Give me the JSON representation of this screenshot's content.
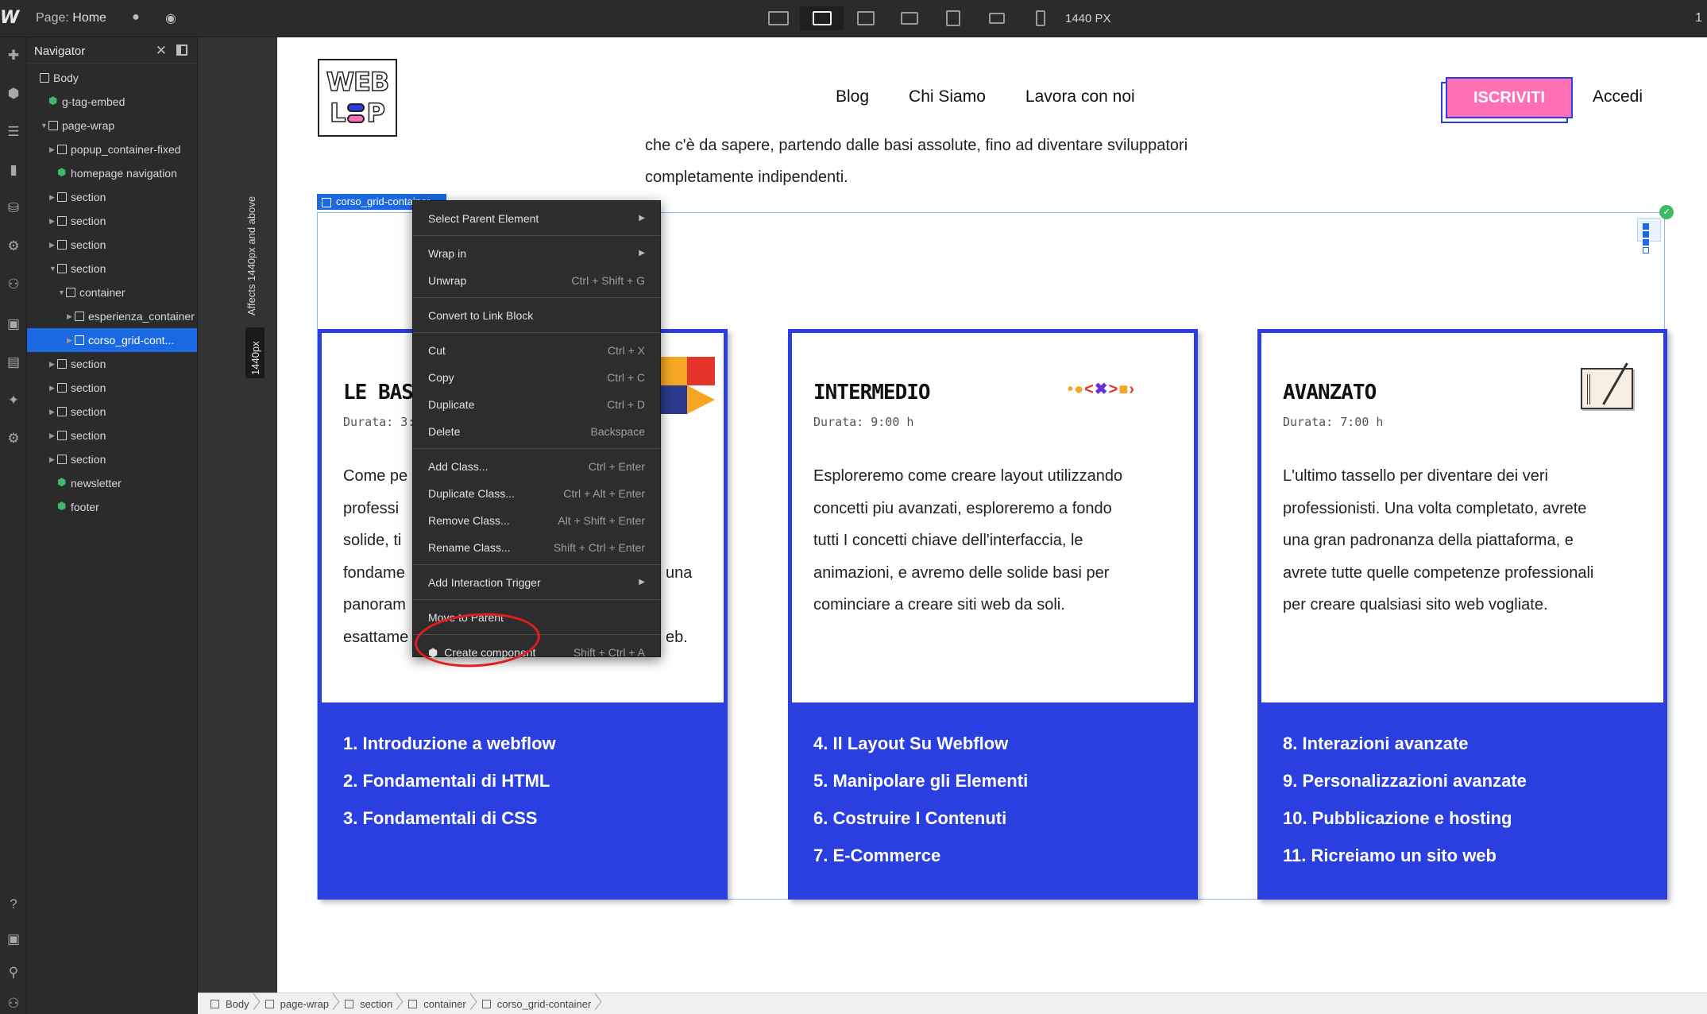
{
  "topbar": {
    "page_prefix": "Page:",
    "page_name": "Home",
    "breakpoint_width": "1440 PX",
    "right_value": "1"
  },
  "navigator": {
    "title": "Navigator",
    "tree": [
      {
        "label": "Body",
        "level": 0,
        "icon": "box",
        "caret": false
      },
      {
        "label": "g-tag-embed",
        "level": 1,
        "icon": "component",
        "caret": false
      },
      {
        "label": "page-wrap",
        "level": 1,
        "icon": "box",
        "caret": "open"
      },
      {
        "label": "popup_container-fixed",
        "level": 2,
        "icon": "box",
        "caret": "closed"
      },
      {
        "label": "homepage navigation",
        "level": 2,
        "icon": "component",
        "caret": false
      },
      {
        "label": "section",
        "level": 2,
        "icon": "box",
        "caret": "closed"
      },
      {
        "label": "section",
        "level": 2,
        "icon": "box",
        "caret": "closed"
      },
      {
        "label": "section",
        "level": 2,
        "icon": "box",
        "caret": "closed"
      },
      {
        "label": "section",
        "level": 2,
        "icon": "box",
        "caret": "open"
      },
      {
        "label": "container",
        "level": 3,
        "icon": "box",
        "caret": "open"
      },
      {
        "label": "esperienza_container",
        "level": 4,
        "icon": "box",
        "caret": "closed"
      },
      {
        "label": "corso_grid-cont...",
        "level": 4,
        "icon": "box",
        "caret": "closed",
        "selected": true
      },
      {
        "label": "section",
        "level": 2,
        "icon": "box",
        "caret": "closed"
      },
      {
        "label": "section",
        "level": 2,
        "icon": "box",
        "caret": "closed"
      },
      {
        "label": "section",
        "level": 2,
        "icon": "box",
        "caret": "closed"
      },
      {
        "label": "section",
        "level": 2,
        "icon": "box",
        "caret": "closed"
      },
      {
        "label": "section",
        "level": 2,
        "icon": "box",
        "caret": "closed"
      },
      {
        "label": "newsletter",
        "level": 2,
        "icon": "component",
        "caret": false
      },
      {
        "label": "footer",
        "level": 2,
        "icon": "component",
        "caret": false
      }
    ]
  },
  "gutter": {
    "affects_text": "Affects 1440px and above",
    "width_tag": "1440px"
  },
  "site": {
    "logo_line1": "WEB",
    "logo_l": "L",
    "logo_p": "P",
    "nav": [
      "Blog",
      "Chi Siamo",
      "Lavora con noi"
    ],
    "cta": "ISCRIVITI",
    "login": "Accedi",
    "intro_line1": "che c'è da sapere, partendo dalle basi assolute, fino ad diventare sviluppatori",
    "intro_line2": "completamente indipendenti.",
    "selected_tag": "corso_grid-container",
    "cards": [
      {
        "title": "LE BASI",
        "duration": "Durata: 3:",
        "desc": [
          "Come pe",
          "professi",
          "solide, ti",
          "fondame",
          "panoram",
          "esattame"
        ],
        "desc_tail": [
          "",
          "",
          "",
          "una",
          "",
          "eb."
        ],
        "lessons": [
          "1. Introduzione a webflow",
          "2. Fondamentali di HTML",
          "3. Fondamentali di CSS"
        ]
      },
      {
        "title": "INTERMEDIO",
        "duration": "Durata: 9:00 h",
        "desc": [
          "Esploreremo come creare layout utilizzando",
          "concetti piu avanzati, esploreremo a fondo",
          "tutti I concetti chiave dell'interfaccia, le",
          "animazioni, e avremo delle solide basi per",
          "cominciare a creare siti web da soli."
        ],
        "lessons": [
          "4. Il Layout Su Webflow",
          "5. Manipolare gli Elementi",
          "6. Costruire I Contenuti",
          "7. E-Commerce"
        ]
      },
      {
        "title": "AVANZATO",
        "duration": "Durata: 7:00 h",
        "desc": [
          "L'ultimo tassello per diventare dei veri",
          "professionisti. Una volta completato, avrete",
          "una gran padronanza della piattaforma, e",
          "avrete tutte quelle competenze professionali",
          "per creare qualsiasi sito web vogliate."
        ],
        "lessons": [
          "8. Interazioni avanzate",
          "9. Personalizzazioni avanzate",
          "10. Pubblicazione e hosting",
          "11. Ricreiamo un sito web"
        ]
      }
    ]
  },
  "context_menu": {
    "items": [
      {
        "label": "Select Parent Element",
        "shortcut": "",
        "submenu": true,
        "sep_after": true
      },
      {
        "label": "Wrap in",
        "shortcut": "",
        "submenu": true
      },
      {
        "label": "Unwrap",
        "shortcut": "Ctrl + Shift + G",
        "sep_after": true
      },
      {
        "label": "Convert to Link Block",
        "shortcut": "",
        "sep_after": true
      },
      {
        "label": "Cut",
        "shortcut": "Ctrl + X"
      },
      {
        "label": "Copy",
        "shortcut": "Ctrl + C"
      },
      {
        "label": "Duplicate",
        "shortcut": "Ctrl + D"
      },
      {
        "label": "Delete",
        "shortcut": "Backspace",
        "sep_after": true
      },
      {
        "label": "Add Class...",
        "shortcut": "Ctrl + Enter"
      },
      {
        "label": "Duplicate Class...",
        "shortcut": "Ctrl + Alt + Enter"
      },
      {
        "label": "Remove Class...",
        "shortcut": "Alt + Shift + Enter"
      },
      {
        "label": "Rename Class...",
        "shortcut": "Shift + Ctrl + Enter",
        "sep_after": true
      },
      {
        "label": "Add Interaction Trigger",
        "shortcut": "",
        "submenu": true,
        "sep_after": true
      },
      {
        "label": "Move to Parent",
        "shortcut": "",
        "sep_after": true
      },
      {
        "label": "Create component",
        "shortcut": "Shift + Ctrl + A",
        "icon": "component"
      }
    ]
  },
  "breadcrumb": [
    "Body",
    "page-wrap",
    "section",
    "container",
    "corso_grid-container"
  ],
  "colors": {
    "brand_blue": "#2b3fe0",
    "selection": "#1a68e2",
    "cta_pink": "#ff6fb5",
    "highlight_red": "#e01e1e"
  }
}
